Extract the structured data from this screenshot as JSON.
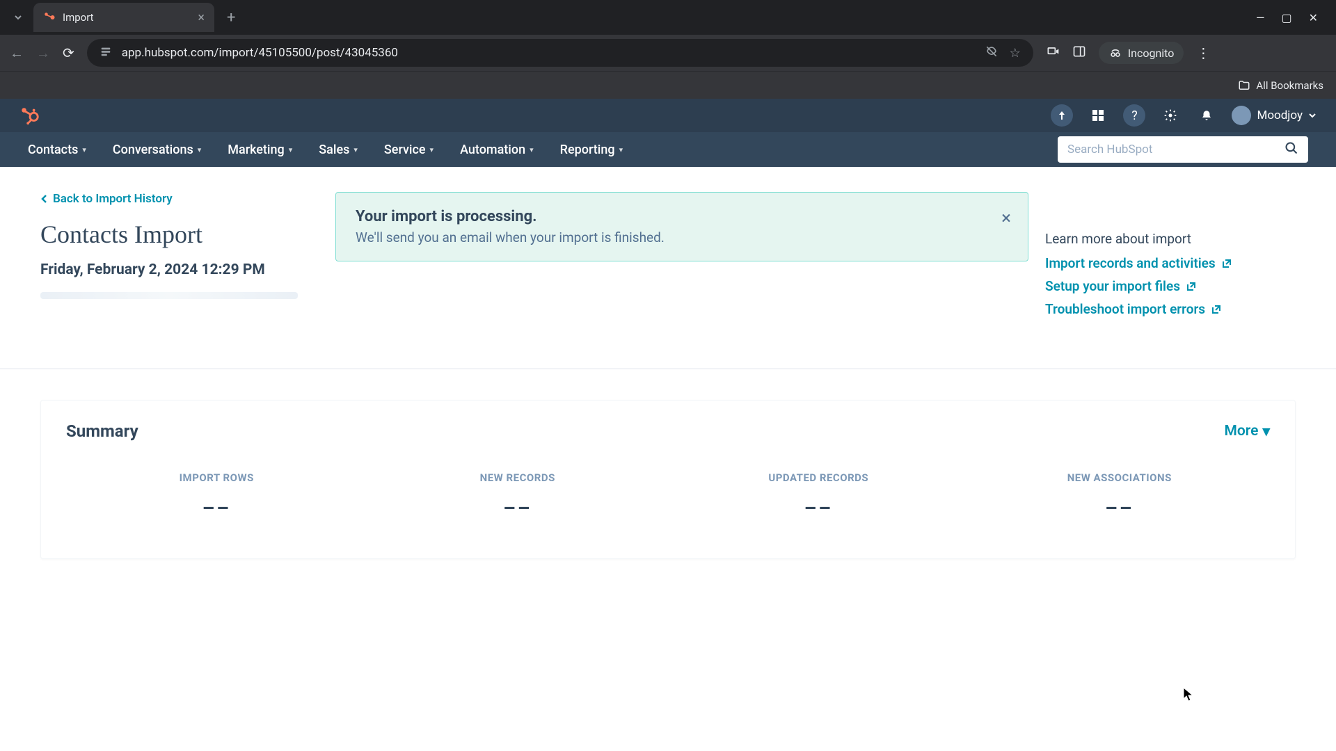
{
  "browser": {
    "tab_title": "Import",
    "url": "app.hubspot.com/import/45105500/post/43045360",
    "incognito_label": "Incognito",
    "all_bookmarks": "All Bookmarks"
  },
  "header": {
    "user_name": "Moodjoy"
  },
  "nav": {
    "items": [
      "Contacts",
      "Conversations",
      "Marketing",
      "Sales",
      "Service",
      "Automation",
      "Reporting"
    ],
    "search_placeholder": "Search HubSpot"
  },
  "page": {
    "back_link": "Back to Import History",
    "title": "Contacts Import",
    "date": "Friday, February 2, 2024 12:29 PM"
  },
  "alert": {
    "title": "Your import is processing.",
    "body": "We'll send you an email when your import is finished."
  },
  "help": {
    "heading": "Learn more about import",
    "links": [
      "Import records and activities",
      "Setup your import files",
      "Troubleshoot import errors"
    ]
  },
  "summary": {
    "title": "Summary",
    "more_label": "More",
    "stats": [
      {
        "label": "IMPORT ROWS",
        "value": "––"
      },
      {
        "label": "NEW RECORDS",
        "value": "––"
      },
      {
        "label": "UPDATED RECORDS",
        "value": "––"
      },
      {
        "label": "NEW ASSOCIATIONS",
        "value": "––"
      }
    ]
  }
}
